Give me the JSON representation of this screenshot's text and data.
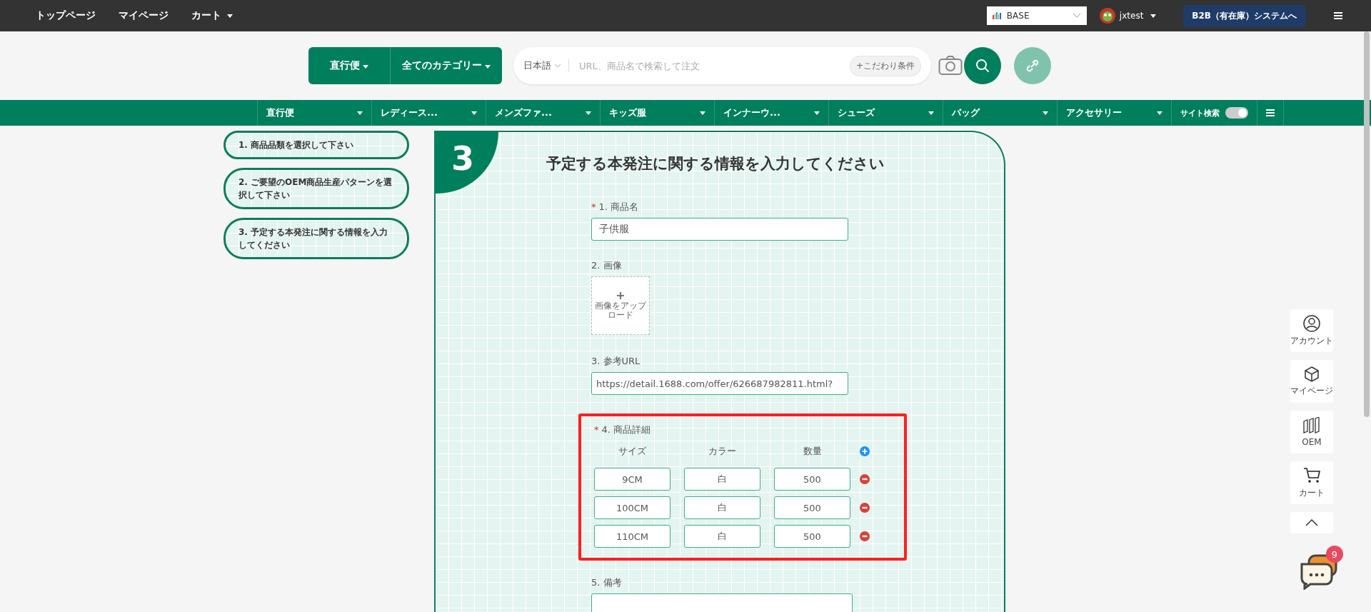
{
  "top_nav": [
    {
      "label": "トップページ",
      "has_menu": false
    },
    {
      "label": "マイページ",
      "has_menu": false
    },
    {
      "label": "カート",
      "has_menu": true
    }
  ],
  "store_select": {
    "value": "BASE"
  },
  "user": {
    "name": "jxtest"
  },
  "b2b_button": "B2B（有在庫）システムへ",
  "search": {
    "channel_button": "直行便",
    "category_button": "全てのカテゴリー",
    "language": "日本語",
    "placeholder": "URL、商品名で検索して注文",
    "filter_button": "+こだわり条件"
  },
  "category_bar": {
    "items": [
      "直行便",
      "レディース...",
      "メンズファ...",
      "キッズ服",
      "インナーウ...",
      "シューズ",
      "バッグ",
      "アクセサリー"
    ],
    "site_search": "サイト検索",
    "site_search_toggle": {
      "on": true
    }
  },
  "steps": [
    {
      "label": "1. 商品品類を選択して下さい"
    },
    {
      "label": "2. ご要望のOEM商品生産パターンを選択して下さい"
    },
    {
      "label": "3. 予定する本発注に関する情報を入力してください"
    }
  ],
  "form": {
    "step_number": "3",
    "title": "予定する本発注に関する情報を入力してください",
    "product_name": {
      "label": "1. 商品名",
      "required_mark": "*",
      "value": "子供服"
    },
    "image": {
      "label": "2. 画像",
      "upload_text": "画像をアップロード"
    },
    "reference_url": {
      "label": "3. 参考URL",
      "value": "https://detail.1688.com/offer/626687982811.html?"
    },
    "details": {
      "label": "4. 商品詳細",
      "required_mark": "*",
      "highlighted": true,
      "columns": [
        "サイズ",
        "カラー",
        "数量"
      ],
      "rows": [
        {
          "size": "9CM",
          "tone": "白",
          "quantity": "500"
        },
        {
          "size": "100CM",
          "tone": "白",
          "quantity": "500"
        },
        {
          "size": "110CM",
          "tone": "白",
          "quantity": "500"
        }
      ]
    },
    "note": {
      "label": "5. 備考"
    }
  },
  "right_rail": [
    {
      "kind": "account",
      "label": "アカウント"
    },
    {
      "kind": "mypage",
      "label": "マイページ"
    },
    {
      "kind": "oem",
      "label": "OEM"
    },
    {
      "kind": "cart",
      "label": "カート"
    }
  ],
  "chat": {
    "badge": "9"
  }
}
